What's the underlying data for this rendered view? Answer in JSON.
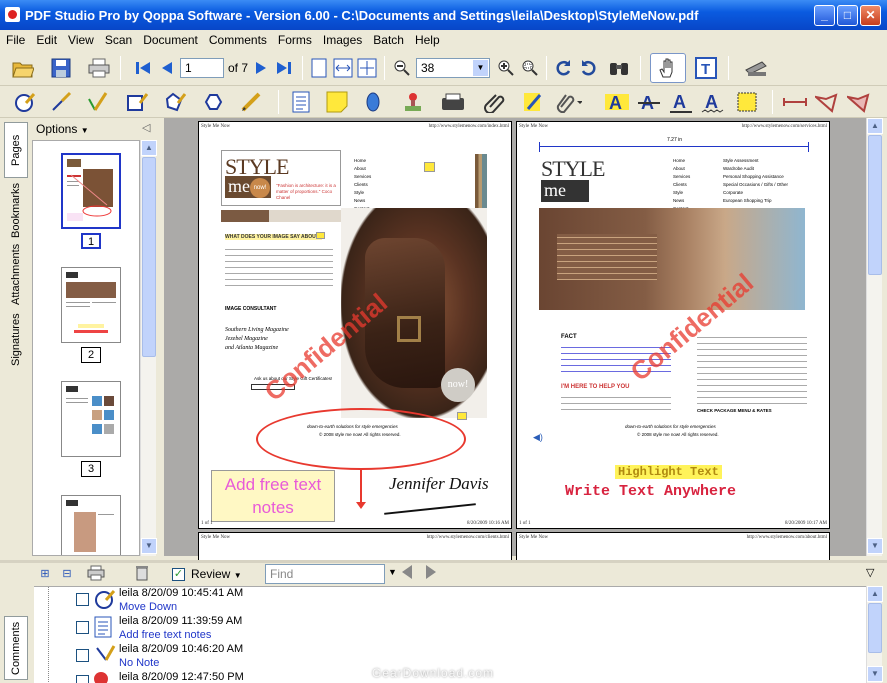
{
  "window": {
    "title": "PDF Studio Pro by Qoppa Software - Version 6.00 - C:\\Documents and Settings\\leila\\Desktop\\StyleMeNow.pdf",
    "minimize": "_",
    "maximize": "□",
    "close": "✕"
  },
  "menu": [
    "File",
    "Edit",
    "View",
    "Scan",
    "Document",
    "Comments",
    "Forms",
    "Images",
    "Batch",
    "Help"
  ],
  "toolbar": {
    "page_value": "1",
    "page_total": "of 7",
    "zoom_value": "38"
  },
  "left_panel": {
    "tabs": [
      "Pages",
      "Bookmarks",
      "Attachments",
      "Signatures"
    ],
    "options_label": "Options",
    "thumbnails": [
      "1",
      "2",
      "3"
    ]
  },
  "page1": {
    "header_left": "Style Me Now",
    "header_right": "http://www.stylemenow.com/index.html",
    "logo_top": "STYLE",
    "logo_bottom": "me",
    "logo_badge": "now!",
    "quote": "\"Fashion is architecture: it is a matter of proportions.\" Coco Chanel",
    "nav": [
      "Home",
      "About",
      "Services",
      "Clients",
      "Style News",
      "Contact"
    ],
    "headline": "WHAT DOES YOUR IMAGE SAY ABOUT?",
    "role": "IMAGE CONSULTANT",
    "mags": "Southern Living Magazine\nJezebel Magazine\nand Atlanta Magazine",
    "ask": "Ask us about our Style Gift Certificates!",
    "watermark": "Confidential",
    "footer1": "down-to-earth solutions for style emergencies",
    "footer2": "© 2008 style me now! All rights reserved.",
    "footer_left": "1 of 1",
    "footer_right": "8/20/2009 10:16 AM",
    "free_text": "Add free text notes",
    "signature": "Jennifer Davis"
  },
  "page2": {
    "header_left": "Style Me Now",
    "header_right": "http://www.stylemenow.com/services.html",
    "measure": "7.27 in",
    "nav": [
      "Home",
      "About",
      "Services",
      "Clients",
      "Style News",
      "Contact"
    ],
    "services": [
      "Style Assessment",
      "Wardrobe Audit",
      "Personal Shopping Assistance",
      "Special Occasions / Gifts / Other",
      "Corporate",
      "European Shopping Trip"
    ],
    "fact": "FACT",
    "help": "I'M HERE TO HELP YOU",
    "check": "CHECK PACKAGE MENU & RATES",
    "watermark": "Confidential",
    "highlight": "Highlight Text",
    "write": "Write Text Anywhere",
    "footer_left": "1 of 1",
    "footer_right": "8/20/2009 10:17 AM"
  },
  "page3": {
    "header_left": "Style Me Now",
    "header_right": "http://www.stylemenow.com/clients.html"
  },
  "page4": {
    "header_left": "Style Me Now",
    "header_right": "http://www.stylemenow.com/about.html"
  },
  "comments": {
    "review_label": "Review",
    "find_placeholder": "Find",
    "side_tab": "Comments",
    "rows": [
      {
        "author": "leila 8/20/09 10:45:41 AM",
        "type": "Move Down"
      },
      {
        "author": "leila 8/20/09 11:39:59 AM",
        "type": "Add free text notes"
      },
      {
        "author": "leila 8/20/09 10:46:20 AM",
        "type": "No Note"
      },
      {
        "author": "leila 8/20/09 12:47:50 PM",
        "type": ""
      }
    ]
  },
  "watermark_text": "GearDownload.com",
  "colors": {
    "accent": "#2036c8",
    "titlebar": "#0a5be0",
    "doc_bg": "#abaaa8",
    "confidential": "#e8392f"
  }
}
